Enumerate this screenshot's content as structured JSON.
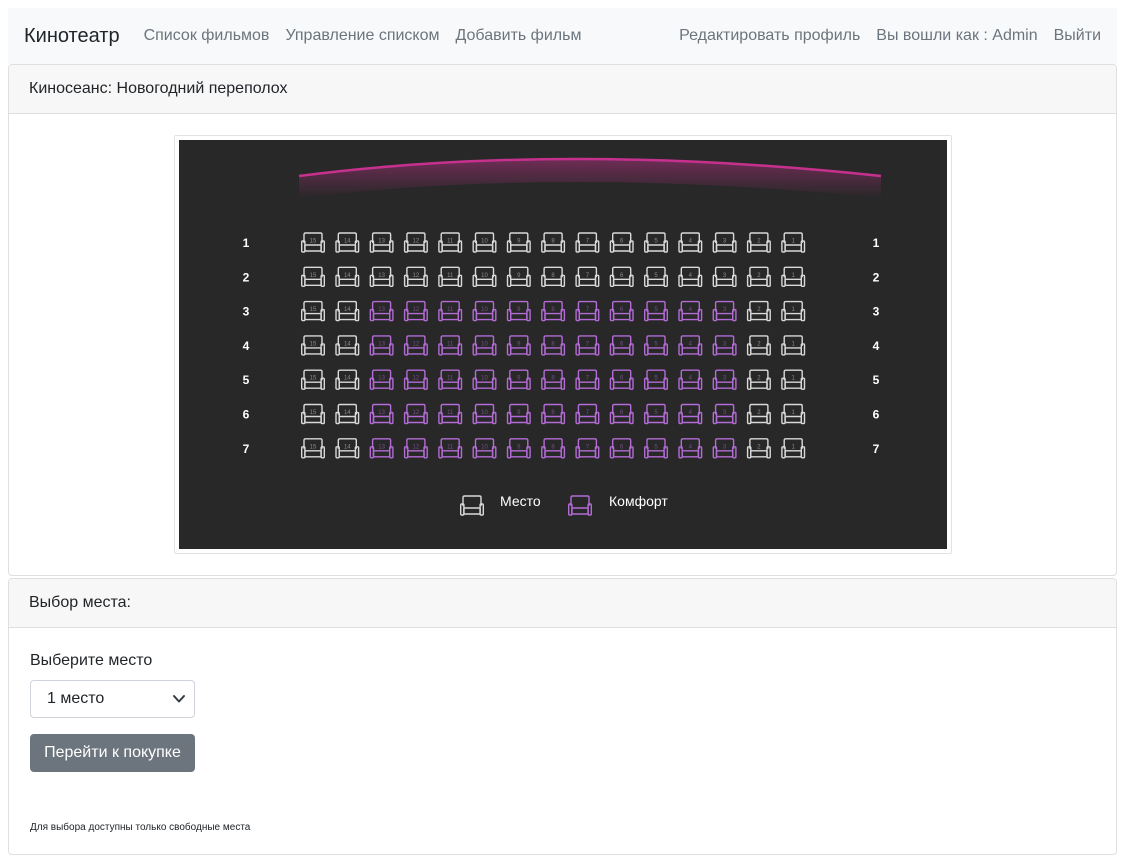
{
  "nav": {
    "brand": "Кинотеатр",
    "links": [
      "Список фильмов",
      "Управление списком",
      "Добавить фильм"
    ],
    "edit_profile": "Редактировать профиль",
    "logged_in": "Вы вошли как : Admin",
    "logout": "Выйти"
  },
  "session": {
    "title": "Киносеанс: Новогодний переполох"
  },
  "hall": {
    "rows": [
      1,
      2,
      3,
      4,
      5,
      6,
      7
    ],
    "seats_per_row": 15,
    "row_comfort": [
      [],
      [],
      [
        3,
        4,
        5,
        6,
        7,
        8,
        9,
        10,
        11,
        12,
        13
      ],
      [
        3,
        4,
        5,
        6,
        7,
        8,
        9,
        10,
        11,
        12,
        13
      ],
      [
        3,
        4,
        5,
        6,
        7,
        8,
        9,
        10,
        11,
        12,
        13
      ],
      [
        3,
        4,
        5,
        6,
        7,
        8,
        9,
        10,
        11,
        12,
        13
      ],
      [
        3,
        4,
        5,
        6,
        7,
        8,
        9,
        10,
        11,
        12,
        13
      ]
    ],
    "legend": {
      "regular": "Место",
      "comfort": "Комфорт"
    },
    "colors": {
      "background": "#282828",
      "screen": "#c7318e",
      "regular_seat": "#d9d9d9",
      "comfort_seat": "#b36bd6",
      "row_label": "#ffffff"
    }
  },
  "selection": {
    "header": "Выбор места:",
    "label": "Выберите место",
    "selected": "1 место",
    "buy_button": "Перейти к покупке",
    "hint": "Для выбора доступны только свободные места"
  }
}
